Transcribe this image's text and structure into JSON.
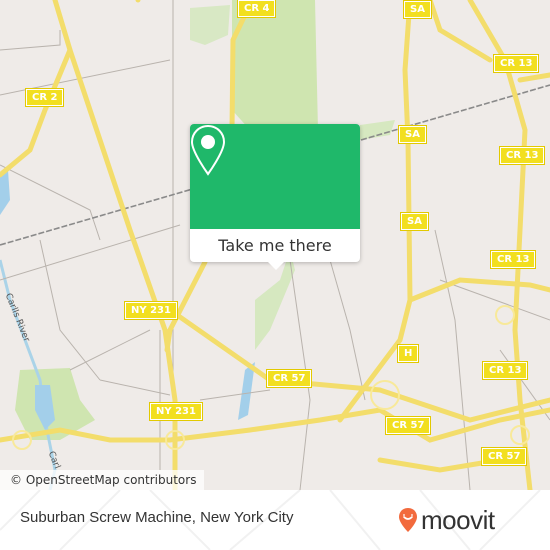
{
  "map": {
    "road_labels": [
      {
        "id": "cr4",
        "text": "CR 4"
      },
      {
        "id": "sa-top",
        "text": "SA"
      },
      {
        "id": "cr13-a",
        "text": "CR 13"
      },
      {
        "id": "cr2",
        "text": "CR 2"
      },
      {
        "id": "sa-mid",
        "text": "SA"
      },
      {
        "id": "cr13-b",
        "text": "CR 13"
      },
      {
        "id": "sa-low",
        "text": "SA"
      },
      {
        "id": "cr13-c",
        "text": "CR 13"
      },
      {
        "id": "ny231-a",
        "text": "NY 231"
      },
      {
        "id": "h",
        "text": "H"
      },
      {
        "id": "cr13-d",
        "text": "CR 13"
      },
      {
        "id": "cr57-a",
        "text": "CR 57"
      },
      {
        "id": "ny231-b",
        "text": "NY 231"
      },
      {
        "id": "cr57-b",
        "text": "CR 57"
      },
      {
        "id": "cr57-c",
        "text": "CR 57"
      }
    ],
    "water_labels": [
      {
        "id": "carlls-river",
        "text": "Carlls River"
      },
      {
        "id": "carlls-river-2",
        "text": "Carl"
      }
    ],
    "attribution": "© OpenStreetMap contributors"
  },
  "popup": {
    "icon": "map-pin-icon",
    "button_label": "Take me there",
    "color": "#1fb86a"
  },
  "footer": {
    "title": "Suburban Screw Machine, New York City",
    "brand": "moovit",
    "brand_icon": "moovit-pin-icon",
    "brand_color": "#f26a3d"
  }
}
